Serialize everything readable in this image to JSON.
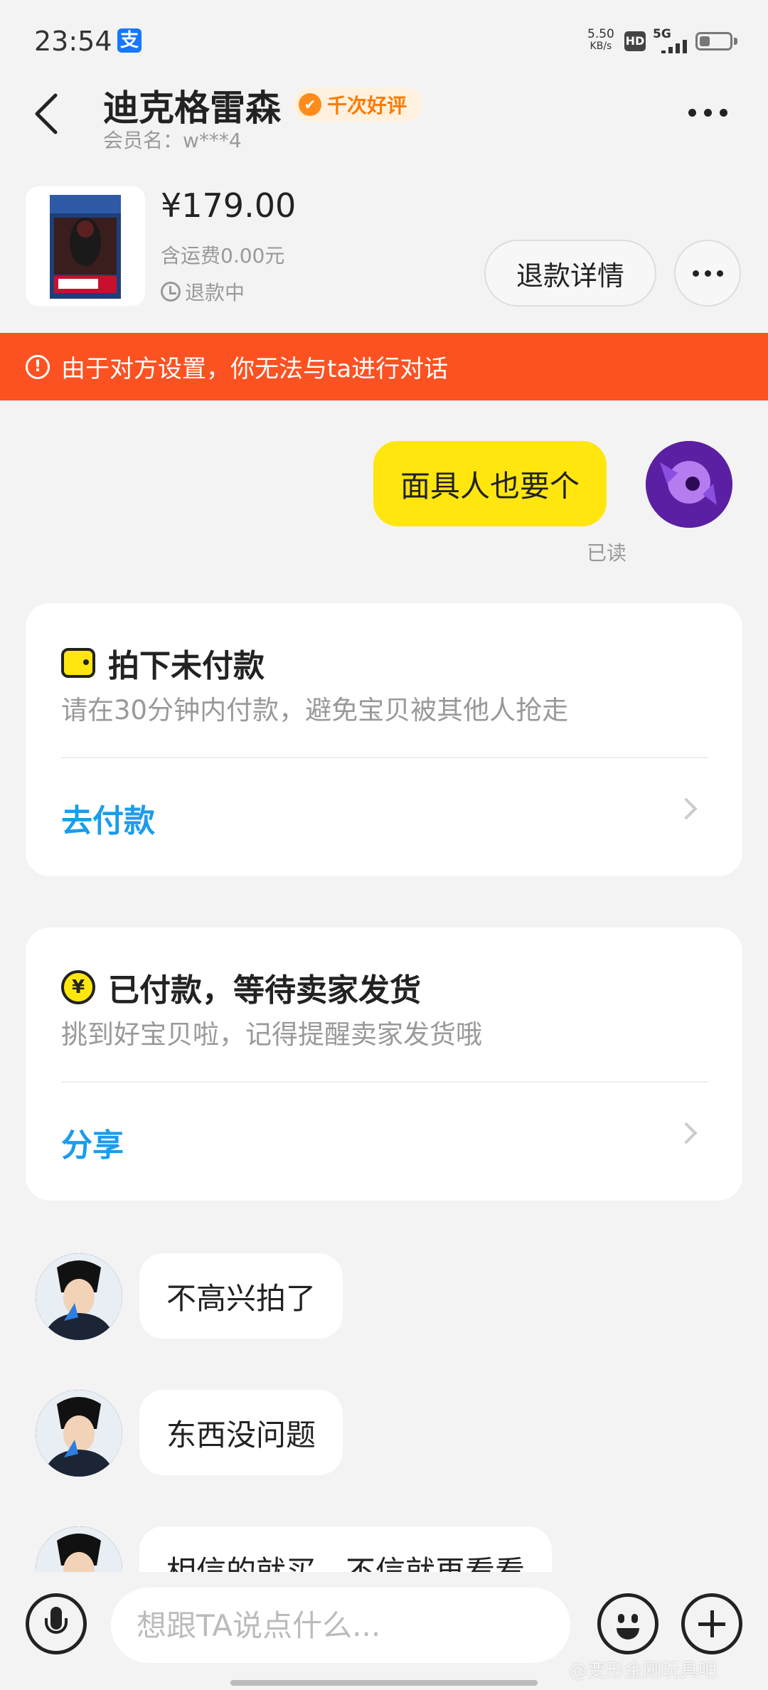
{
  "status_bar": {
    "time": "23:54",
    "net_speed_value": "5.50",
    "net_speed_unit": "KB/s",
    "hd": "HD",
    "network": "5G",
    "icons": [
      "alipay-icon",
      "hd-icon",
      "signal-icon",
      "battery-icon"
    ]
  },
  "header": {
    "shop_name": "迪克格雷森",
    "badge": "千次好评",
    "member": "会员名：w***4"
  },
  "product": {
    "price": "¥179.00",
    "shipping": "含运费0.00元",
    "status": "退款中",
    "refund_button": "退款详情"
  },
  "warning": {
    "text": "由于对方设置，你无法与ta进行对话",
    "color": "#fc5222"
  },
  "messages": {
    "mine": {
      "text": "面具人也要个",
      "status": "已读",
      "bubble_color": "#ffe60f"
    },
    "incoming": [
      {
        "text": "不高兴拍了"
      },
      {
        "text": "东西没问题"
      },
      {
        "text": "相信的就买，不信就再看看"
      }
    ]
  },
  "cards": [
    {
      "title": "拍下未付款",
      "subtitle": "请在30分钟内付款，避免宝贝被其他人抢走",
      "action": "去付款",
      "icon": "wallet-icon"
    },
    {
      "title": "已付款，等待卖家发货",
      "subtitle": "挑到好宝贝啦，记得提醒卖家发货哦",
      "action": "分享",
      "icon": "yen-icon"
    }
  ],
  "input": {
    "placeholder": "想跟TA说点什么...",
    "value": ""
  },
  "watermark": "@变形金刚玩具吧",
  "colors": {
    "accent_link": "#1a9cec",
    "badge_text": "#ff7a00"
  }
}
